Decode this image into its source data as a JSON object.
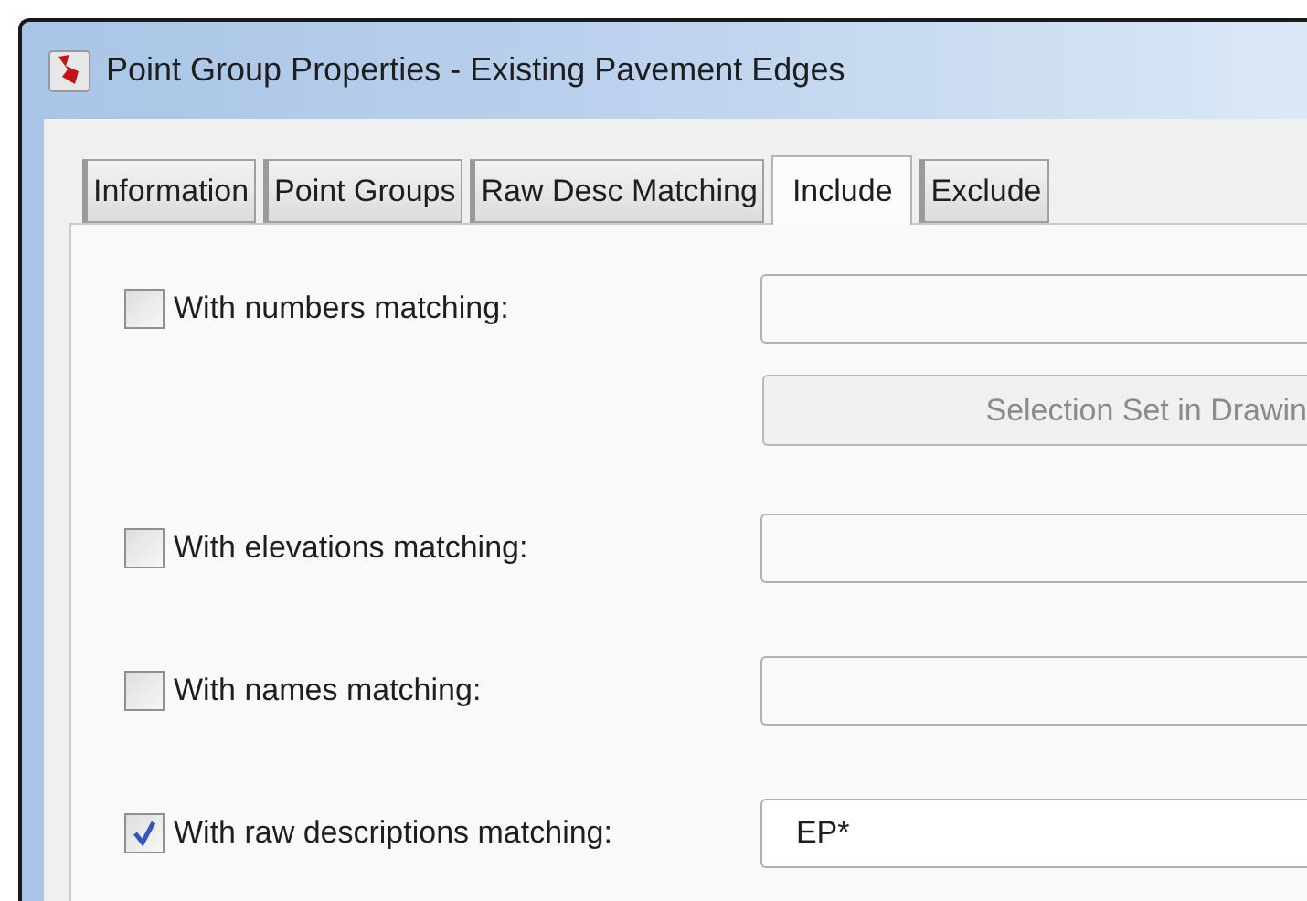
{
  "window": {
    "title": "Point Group Properties - Existing Pavement Edges"
  },
  "tabs": [
    {
      "label": "Information",
      "selected": false
    },
    {
      "label": "Point Groups",
      "selected": false
    },
    {
      "label": "Raw Desc Matching",
      "selected": false
    },
    {
      "label": "Include",
      "selected": true
    },
    {
      "label": "Exclude",
      "selected": false
    }
  ],
  "rows": [
    {
      "label": "With numbers matching:",
      "checked": false,
      "value": "",
      "button": "Selection Set in Drawin"
    },
    {
      "label": "With elevations matching:",
      "checked": false,
      "value": ""
    },
    {
      "label": "With names matching:",
      "checked": false,
      "value": ""
    },
    {
      "label": "With raw descriptions matching:",
      "checked": true,
      "value": "EP*"
    }
  ]
}
